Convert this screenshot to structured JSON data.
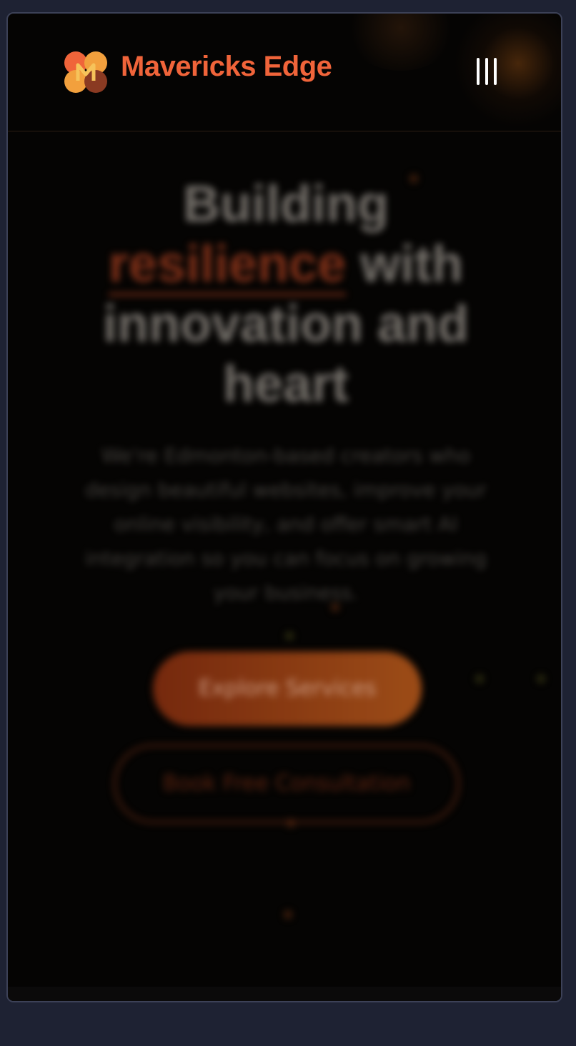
{
  "header": {
    "brand_name": "Mavericks Edge",
    "logo_icon": "mavericks-m-logo-icon",
    "menu_icon": "menu-bars-icon"
  },
  "hero": {
    "headline_part1": "Building",
    "headline_accent": "resilience",
    "headline_part2": "with innovation and heart",
    "subtext": "We're Edmonton-based creators who design beautiful websites, improve your online visibility, and offer smart AI integration so you can focus on growing your business.",
    "primary_button_label": "Explore Services",
    "secondary_button_label": "Book Free Consultation"
  },
  "colors": {
    "page_background": "#1e2233",
    "frame_background": "#050403",
    "brand_orange": "#f0643a",
    "accent": "#e2542a"
  }
}
